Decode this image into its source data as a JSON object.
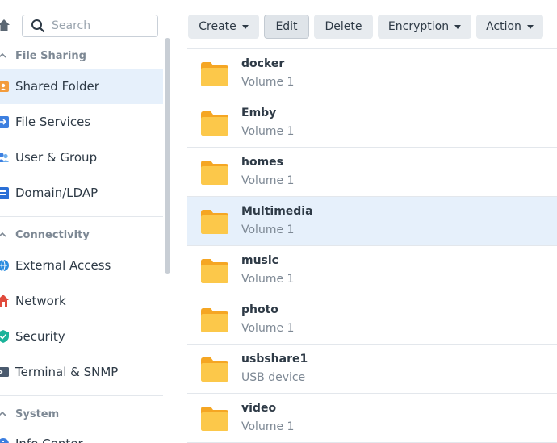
{
  "search": {
    "placeholder": "Search"
  },
  "sidebar": {
    "sections": [
      {
        "title": "File Sharing"
      },
      {
        "title": "Connectivity"
      },
      {
        "title": "System"
      }
    ],
    "items": [
      {
        "label": "Shared Folder",
        "icon": "shared-folder-icon",
        "active": true
      },
      {
        "label": "File Services",
        "icon": "file-services-icon"
      },
      {
        "label": "User & Group",
        "icon": "user-group-icon"
      },
      {
        "label": "Domain/LDAP",
        "icon": "domain-ldap-icon"
      },
      {
        "label": "External Access",
        "icon": "external-access-icon"
      },
      {
        "label": "Network",
        "icon": "network-icon"
      },
      {
        "label": "Security",
        "icon": "security-icon"
      },
      {
        "label": "Terminal & SNMP",
        "icon": "terminal-icon"
      },
      {
        "label": "Info Center",
        "icon": "info-center-icon"
      }
    ]
  },
  "toolbar": {
    "create": "Create",
    "edit": "Edit",
    "delete": "Delete",
    "encryption": "Encryption",
    "action": "Action"
  },
  "folders": [
    {
      "name": "docker",
      "location": "Volume 1"
    },
    {
      "name": "Emby",
      "location": "Volume 1"
    },
    {
      "name": "homes",
      "location": "Volume 1"
    },
    {
      "name": "Multimedia",
      "location": "Volume 1",
      "selected": true
    },
    {
      "name": "music",
      "location": "Volume 1"
    },
    {
      "name": "photo",
      "location": "Volume 1"
    },
    {
      "name": "usbshare1",
      "location": "USB device"
    },
    {
      "name": "video",
      "location": "Volume 1"
    }
  ],
  "colors": {
    "accent_selected": "#e6f0fb",
    "folder": "#fbc035",
    "button_bg": "#e7ebef"
  }
}
